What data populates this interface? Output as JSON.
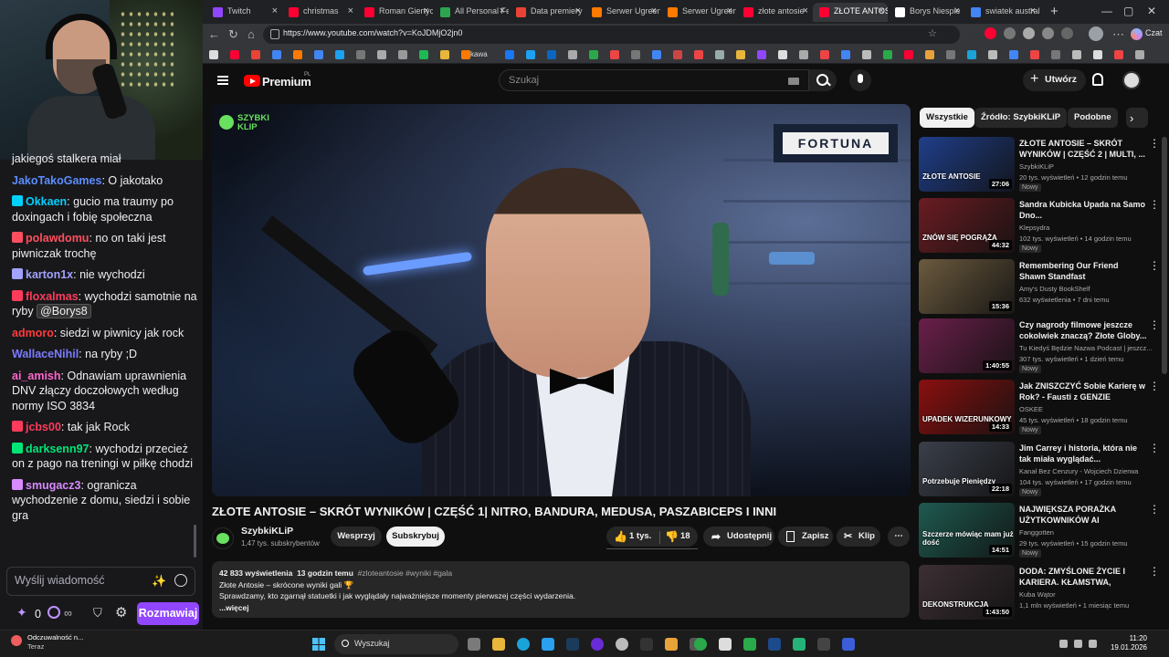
{
  "chat": {
    "partial_text": "jakiegoś stalkera miał",
    "messages": [
      {
        "user": "JakoTakoGames",
        "color": "#5c8dff",
        "text": "O jakotako"
      },
      {
        "user": "Okkaen",
        "color": "#00d1ff",
        "text": "gucio ma traumy po doxingach i fobię społeczna"
      },
      {
        "user": "polawdomu",
        "color": "#ff4f5e",
        "text": "no on taki jest piwniczak trochę"
      },
      {
        "user": "karton1x",
        "color": "#a2a2ff",
        "text": "nie wychodzi"
      },
      {
        "user": "floxalmas",
        "color": "#ff3b5c",
        "text": "wychodzi samotnie na ryby",
        "mention": "@Borys8"
      },
      {
        "user": "admoro",
        "color": "#ff3b3b",
        "text": "siedzi w piwnicy jak rock"
      },
      {
        "user": "WallaceNihil",
        "color": "#7b7bff",
        "text": "na ryby ;D"
      },
      {
        "user": "ai_amish",
        "color": "#ff66cc",
        "text": "Odnawiam uprawnienia DNV złączy doczołowych według normy ISO 3834"
      },
      {
        "user": "jcbs00",
        "color": "#ff3b5c",
        "text": "tak jak Rock"
      },
      {
        "user": "darksenn97",
        "color": "#00e676",
        "text": "wychodzi przecież on z pago na treningi w piłkę chodzi"
      },
      {
        "user": "smugacz3",
        "color": "#d88bff",
        "text": "ogranicza wychodzenie z domu, siedzi i sobie gra"
      }
    ],
    "input_placeholder": "Wyślij wiadomość",
    "points": "0",
    "infinity": "∞",
    "send_label": "Rozmawiaj"
  },
  "browser": {
    "tabs": [
      {
        "label": "Twitch",
        "color": "#9146ff"
      },
      {
        "label": "christmas",
        "color": "#ff0033"
      },
      {
        "label": "Roman Giertych",
        "color": "#ff0033"
      },
      {
        "label": "All Personal Fe",
        "color": "#2da44e"
      },
      {
        "label": "Data premiery",
        "color": "#ea4335"
      },
      {
        "label": "Serwer Ugreen",
        "color": "#ff7a00"
      },
      {
        "label": "Serwer Ugreen",
        "color": "#ff7a00"
      },
      {
        "label": "złote antosie",
        "color": "#ff0033"
      },
      {
        "label": "ZŁOTE ANTOSIE",
        "color": "#ff0033"
      },
      {
        "label": "Borys Niespie",
        "color": "#ffffff"
      },
      {
        "label": "swiatek austral",
        "color": "#4285f4"
      }
    ],
    "url": "https://www.youtube.com/watch?v=KoJDMjO2jn0",
    "czat_label": "Czat",
    "bookmark_label": "kawa"
  },
  "youtube": {
    "logo_label": "Premium",
    "country": "PL",
    "search_placeholder": "Szukaj",
    "create_label": "Utwórz",
    "overlay_logo": "SZYBKI KLIP",
    "sponsor": "FORTUNA",
    "title": "ZŁOTE ANTOSIE – SKRÓT WYNIKÓW | CZĘŚĆ 1| NITRO, BANDURA, MEDUSA, PASZABICEPS I INNI",
    "channel": "SzybkiKLiP",
    "subscribers": "1,47 tys. subskrybentów",
    "support_label": "Wesprzyj",
    "subscribe_label": "Subskrybuj",
    "likes": "1 tys.",
    "dislikes": "18",
    "share_label": "Udostępnij",
    "save_label": "Zapisz",
    "clip_label": "Klip",
    "description": {
      "views": "42 833 wyświetlenia",
      "age": "13 godzin temu",
      "tags": "#zloteantosie #wyniki #gala",
      "line1": "Złote Antosie – skrócone wyniki gali 🏆",
      "line2": "Sprawdzamy, kto zgarnął statuetki i jak wyglądały najważniejsze momenty pierwszej części wydarzenia.",
      "more": "...więcej"
    },
    "chips": [
      "Wszystkie",
      "Źródło: SzybkiKLiP",
      "Podobne"
    ],
    "recommendations": [
      {
        "title": "ZŁOTE ANTOSIE – SKRÓT WYNIKÓW | CZĘŚĆ 2 | MULTI, ...",
        "channel": "SzybkiKLiP",
        "stats": "20 tys. wyświetleń • 12 godzin temu",
        "badge": "Nowy",
        "duration": "27:06",
        "thumb_text": "ZŁOTE ANTOSIE",
        "bg": "#1f3f8a"
      },
      {
        "title": "Sandra Kubicka Upada na Samo Dno...",
        "channel": "Klepsydra",
        "stats": "102 tys. wyświetleń • 14 godzin temu",
        "badge": "Nowy",
        "duration": "44:32",
        "thumb_text": "ZNÓW SIĘ POGRĄŻA",
        "bg": "#6a1c22"
      },
      {
        "title": "Remembering Our Friend Shawn Standfast",
        "channel": "Amy's Dusty BookShelf",
        "stats": "632 wyświetlenia • 7 dni temu",
        "badge": "",
        "duration": "15:36",
        "thumb_text": "",
        "bg": "#6b5a3e"
      },
      {
        "title": "Czy nagrody filmowe jeszcze cokolwiek znaczą? Złote Globy...",
        "channel": "Tu Kiedyś Będzie Nazwa Podcast | jeszcz...",
        "stats": "307 tys. wyświetleń • 1 dzień temu",
        "badge": "Nowy",
        "duration": "1:40:55",
        "thumb_text": "",
        "bg": "#6b1f4a"
      },
      {
        "title": "Jak ZNISZCZYĆ Sobie Karierę w Rok? - Fausti z GENZIE",
        "channel": "OSKEE",
        "stats": "45 tys. wyświetleń • 18 godzin temu",
        "badge": "Nowy",
        "duration": "14:33",
        "thumb_text": "UPADEK WIZERUNKOWY",
        "bg": "#8a1010"
      },
      {
        "title": "Jim Carrey i historia, która nie tak miała wyglądać...",
        "channel": "Kanał Bez Cenzury - Wojciech Dzierwa",
        "stats": "104 tys. wyświetleń • 17 godzin temu",
        "badge": "Nowy",
        "duration": "22:18",
        "thumb_text": "Potrzebuje Pieniędzy",
        "bg": "#3a3f4a"
      },
      {
        "title": "NAJWIĘKSZA PORAŻKA UŻYTKOWNIKÓW AI",
        "channel": "Fanggotten",
        "stats": "29 tys. wyświetleń • 15 godzin temu",
        "badge": "Nowy",
        "duration": "14:51",
        "thumb_text": "Szczerze mówiąc mam już dość",
        "bg": "#1e5a50"
      },
      {
        "title": "DODA: ZMYŚLONE ŻYCIE I KARIERA. KŁAMSTWA, AFERY,...",
        "channel": "Kuba Wątor",
        "stats": "1,1 mln wyświetleń • 1 miesiąc temu",
        "badge": "",
        "duration": "1:43:50",
        "thumb_text": "DEKONSTRUKCJA",
        "bg": "#3c2f33"
      }
    ]
  },
  "taskbar": {
    "notif_title": "Odczuwalność n...",
    "notif_sub": "Teraz",
    "search_placeholder": "Wyszukaj",
    "time": "11:20",
    "date": "19.01.2026"
  }
}
